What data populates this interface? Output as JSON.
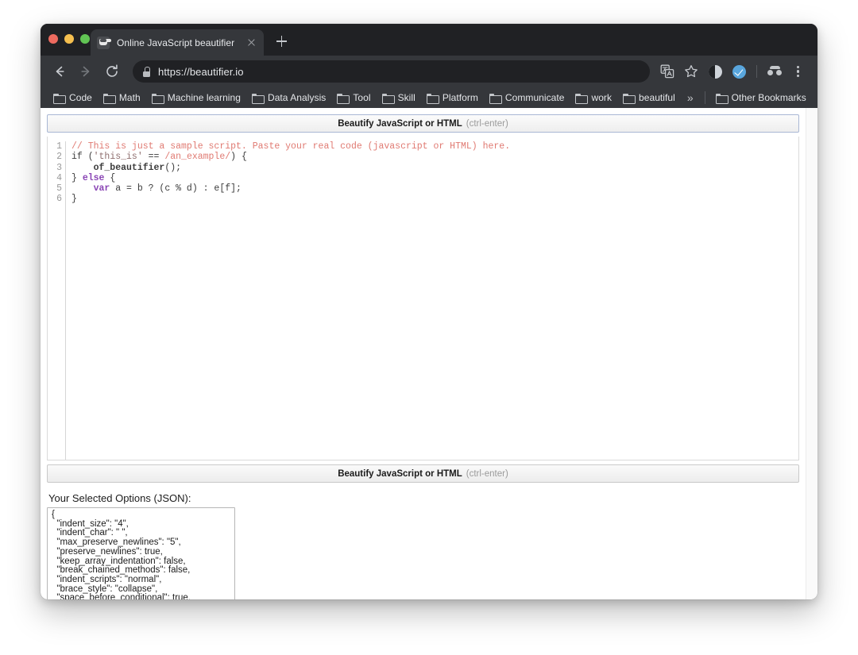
{
  "window": {
    "traffic_lights": [
      "close",
      "minimize",
      "zoom"
    ]
  },
  "tabs": [
    {
      "title": "Online JavaScript beautifier",
      "favicon": "beautifier-favicon",
      "active": true
    }
  ],
  "new_tab_label": "+",
  "toolbar": {
    "back": "back-arrow",
    "forward": "forward-arrow",
    "reload": "reload-arrow",
    "url": "https://beautifier.io",
    "lock": "lock-icon",
    "icons": [
      "translate-icon",
      "bookmark-star-icon",
      "extension-dark-icon",
      "extension-blue-check-icon",
      "incognito-icon",
      "chrome-menu-icon"
    ]
  },
  "bookmarks": {
    "items": [
      {
        "label": "Code"
      },
      {
        "label": "Math"
      },
      {
        "label": "Machine learning"
      },
      {
        "label": "Data Analysis"
      },
      {
        "label": "Tool"
      },
      {
        "label": "Skill"
      },
      {
        "label": "Platform"
      },
      {
        "label": "Communicate"
      },
      {
        "label": "work"
      },
      {
        "label": "beautiful"
      }
    ],
    "overflow": "»",
    "other": {
      "label": "Other Bookmarks"
    }
  },
  "page": {
    "top_header": {
      "title": "Beautify JavaScript or HTML",
      "hint": "(ctrl-enter)"
    },
    "bottom_header": {
      "title": "Beautify JavaScript or HTML",
      "hint": "(ctrl-enter)"
    },
    "editor": {
      "line_numbers": "1\n2\n3\n4\n5\n6",
      "lines": [
        "// This is just a sample script. Paste your real code (javascript or HTML) here.",
        "if ('this_is' == /an_example/) {",
        "    of_beautifier();",
        "} else {",
        "    var a = b ? (c % d) : e[f];",
        "}"
      ]
    },
    "options_label": "Your Selected Options (JSON):",
    "options_json": "{\n  \"indent_size\": \"4\",\n  \"indent_char\": \" \",\n  \"max_preserve_newlines\": \"5\",\n  \"preserve_newlines\": true,\n  \"keep_array_indentation\": false,\n  \"break_chained_methods\": false,\n  \"indent_scripts\": \"normal\",\n  \"brace_style\": \"collapse\",\n  \"space_before_conditional\": true,"
  },
  "colors": {
    "chrome_tabstrip": "#202124",
    "chrome_toolbar": "#35373b",
    "omnibox": "#202124",
    "accent_border": "#a9b7d4",
    "comment": "#e07a72",
    "keyword": "#8a45b5",
    "text": "#3c3c3c"
  }
}
